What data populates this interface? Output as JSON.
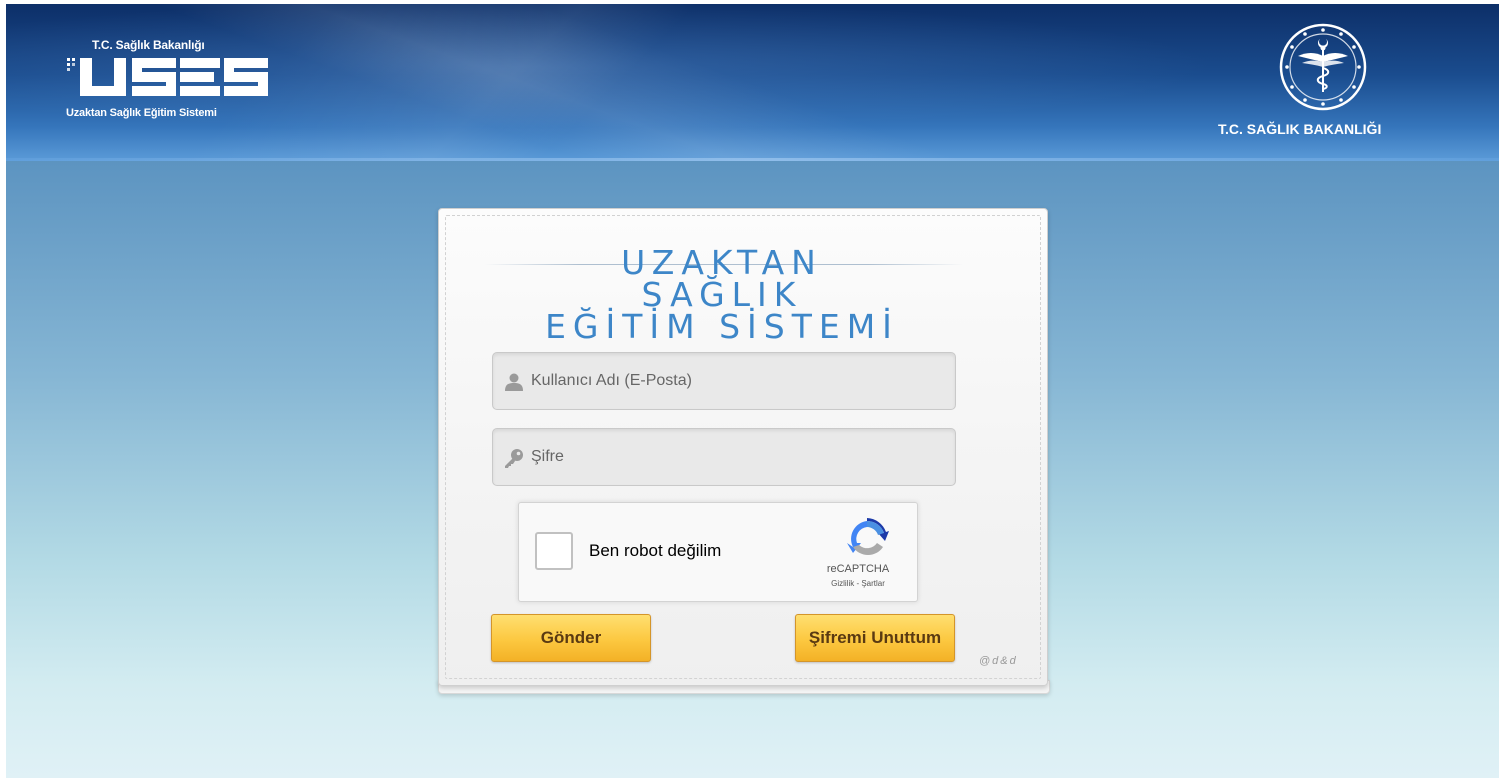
{
  "header": {
    "left_logo": {
      "top_text": "T.C. Sağlık Bakanlığı",
      "acronym": "USES",
      "bottom_text": "Uzaktan Sağlık Eğitim Sistemi"
    },
    "right_logo": {
      "ministry_name": "T.C. SAĞLIK BAKANLIĞI"
    }
  },
  "login": {
    "title_line1": "UZAKTAN SAĞLIK",
    "title_line2": "EĞİTİM SİSTEMİ",
    "username": {
      "placeholder": "Kullanıcı Adı (E-Posta)",
      "value": ""
    },
    "password": {
      "placeholder": "Şifre",
      "value": ""
    },
    "captcha": {
      "label": "Ben robot değilim",
      "brand": "reCAPTCHA",
      "links": "Gizlilik - Şartlar",
      "checked": false
    },
    "submit_label": "Gönder",
    "forgot_label": "Şifremi Unuttum",
    "credit": "@d&d"
  },
  "colors": {
    "header_dark": "#0d2f68",
    "title_blue": "#3d86c8",
    "button_yellow": "#fcc840",
    "button_text": "#5a3a12"
  },
  "icons": {
    "username": "user-icon",
    "password": "key-icon",
    "captcha": "recaptcha-logo-icon",
    "emblem": "caduceus-emblem-icon"
  }
}
